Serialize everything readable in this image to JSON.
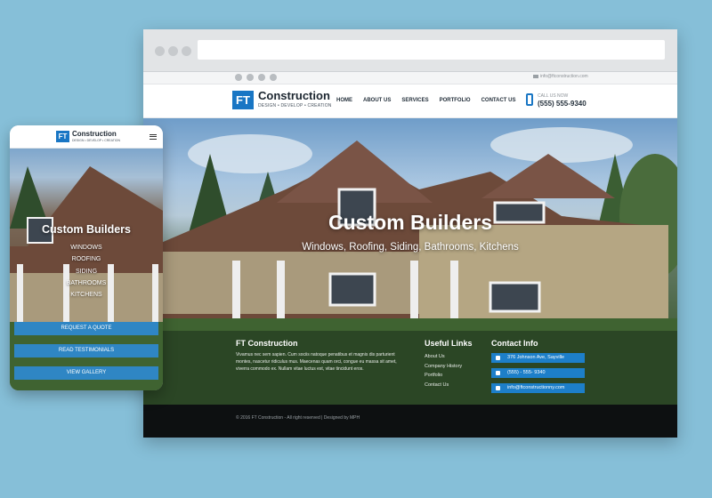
{
  "desktop": {
    "topbar_email": "info@ftconstruction.com",
    "brand": {
      "mark": "FT",
      "name": "Construction",
      "tagline": "DESIGN • DEVELOP • CREATION"
    },
    "nav": [
      "HOME",
      "ABOUT US",
      "SERVICES",
      "PORTFOLIO",
      "CONTACT US"
    ],
    "call": {
      "label": "CALL US NOW",
      "number": "(555) 555-9340"
    },
    "hero": {
      "title": "Custom Builders",
      "subtitle": "Windows, Roofing, Siding, Bathrooms, Kitchens"
    },
    "footer": {
      "about_title": "FT Construction",
      "about_text": "Vivamus nec sem sapien. Cum sociis natoque penatibus et magnis dis parturient montes, nascetur ridiculus mus. Maecenas quam orci, congue eu massa sit amet, viverra commodo ex. Nullam vitae luctus est, vitae tincidunt eros.",
      "links_title": "Useful Links",
      "links": [
        "About Us",
        "Company History",
        "Portfolio",
        "Contact Us"
      ],
      "contact_title": "Contact Info",
      "contact": [
        "376 Johnson Ave, Sayville",
        "(555) - 555- 9340",
        "info@ftconstructionny.com"
      ]
    },
    "copyright": "© 2016 FT Construction - All right reserved | Designed by MPH"
  },
  "mobile": {
    "brand": {
      "mark": "FT",
      "name": "Construction",
      "tagline": "DESIGN • DEVELOP • CREATION"
    },
    "hero_title": "Custom Builders",
    "services": [
      "WINDOWS",
      "ROOFING",
      "SIDING",
      "BATHROOMS",
      "KITCHENS"
    ],
    "buttons": [
      "REQUEST A QUOTE",
      "READ TESTIMONIALS",
      "VIEW GALLERY"
    ]
  }
}
